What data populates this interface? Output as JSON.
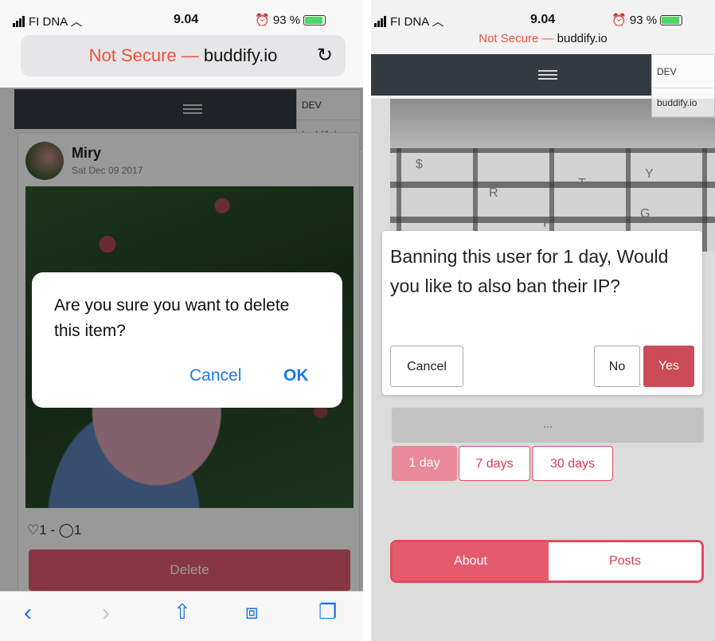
{
  "left": {
    "status": {
      "carrier": "FI DNA",
      "time": "9.04",
      "battery": "93 %"
    },
    "address": {
      "not_secure": "Not Secure —",
      "domain": "buddify.io"
    },
    "dev_menu": {
      "dev": "DEV",
      "site": "buddify.io"
    },
    "post": {
      "user": "Miry",
      "date": "Sat Dec 09 2017",
      "reactions": "♡1 - ◯1",
      "delete_label": "Delete"
    },
    "alert": {
      "message": "Are you sure you want to delete this item?",
      "cancel": "Cancel",
      "ok": "OK"
    }
  },
  "right": {
    "status": {
      "carrier": "FI DNA",
      "time": "9.04",
      "battery": "93 %"
    },
    "address": {
      "not_secure": "Not Secure —",
      "domain": "buddify.io"
    },
    "dev_menu": {
      "dev": "DEV",
      "site": "buddify.io"
    },
    "modal": {
      "message": "Banning this user for 1 day, Would you like to also ban their IP?",
      "cancel": "Cancel",
      "no": "No",
      "yes": "Yes"
    },
    "ellipsis": "...",
    "ban_options": {
      "d1": "1 day",
      "d7": "7 days",
      "d30": "30 days"
    },
    "tabs": {
      "about": "About",
      "posts": "Posts"
    }
  },
  "colors": {
    "accent": "#e04a60",
    "ios_blue": "#1a7ae6",
    "navbar": "#343a40",
    "not_secure": "#f0503c"
  }
}
